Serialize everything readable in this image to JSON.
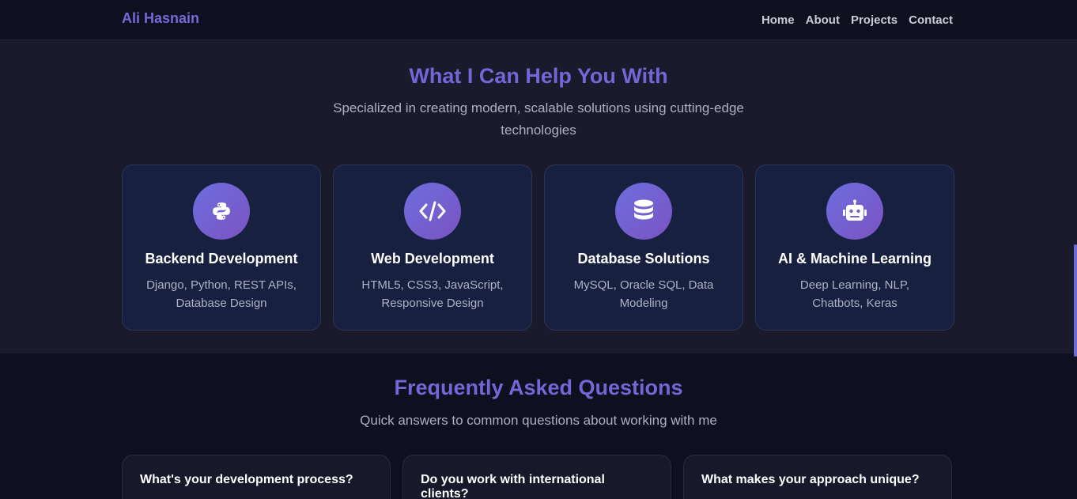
{
  "nav": {
    "brand": "Ali Hasnain",
    "links": [
      "Home",
      "About",
      "Projects",
      "Contact"
    ]
  },
  "services": {
    "title": "What I Can Help You With",
    "subtitle_line1": "Specialized in creating modern, scalable solutions using cutting-edge",
    "subtitle_line2": "technologies",
    "cards": [
      {
        "icon": "python-icon",
        "title": "Backend Development",
        "desc_line1": "Django, Python, REST APIs,",
        "desc_line2": "Database Design"
      },
      {
        "icon": "code-icon",
        "title": "Web Development",
        "desc_line1": "HTML5, CSS3, JavaScript,",
        "desc_line2": "Responsive Design"
      },
      {
        "icon": "database-icon",
        "title": "Database Solutions",
        "desc_line1": "MySQL, Oracle SQL, Data",
        "desc_line2": "Modeling"
      },
      {
        "icon": "robot-icon",
        "title": "AI & Machine Learning",
        "desc_line1": "Deep Learning, NLP,",
        "desc_line2": "Chatbots, Keras"
      }
    ]
  },
  "faq": {
    "title": "Frequently Asked Questions",
    "subtitle": "Quick answers to common questions about working with me",
    "questions": [
      {
        "line1": "What's your development process?",
        "line2": ""
      },
      {
        "line1": "Do you work with international",
        "line2": "clients?"
      },
      {
        "line1": "What makes your approach unique?",
        "line2": ""
      }
    ]
  },
  "colors": {
    "accent": "#7665d6",
    "card_bg": "#17203f",
    "page_bg": "#0f0f1f",
    "section_bg": "#1a1a2c"
  }
}
